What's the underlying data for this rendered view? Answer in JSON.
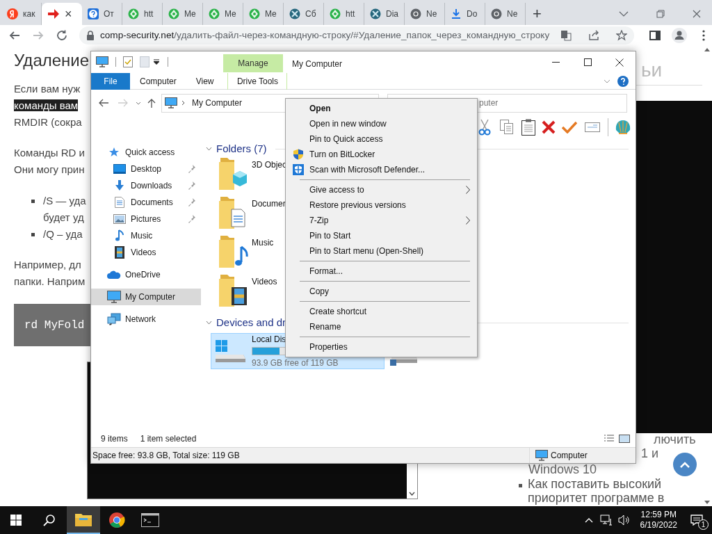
{
  "browser": {
    "tabs": [
      {
        "kind": "yandex",
        "label": "как",
        "selected": false
      },
      {
        "kind": "arrow",
        "close": "×",
        "selected": true
      },
      {
        "kind": "question",
        "label": "От",
        "selected": false
      },
      {
        "kind": "globe",
        "label": "htt",
        "selected": false
      },
      {
        "kind": "globe",
        "label": "Me",
        "selected": false
      },
      {
        "kind": "globe",
        "label": "Me",
        "selected": false
      },
      {
        "kind": "globe",
        "label": "Me",
        "selected": false
      },
      {
        "kind": "xbox",
        "label": "Сб",
        "selected": false
      },
      {
        "kind": "globe",
        "label": "htt",
        "selected": false
      },
      {
        "kind": "xbox",
        "label": "Dia",
        "selected": false
      },
      {
        "kind": "chrome",
        "label": "Ne",
        "selected": false
      },
      {
        "kind": "download",
        "label": "Do",
        "selected": false
      },
      {
        "kind": "chrome",
        "label": "Ne",
        "selected": false
      }
    ],
    "new_tab": "+",
    "url": {
      "domain": "comp-security.net",
      "path": "/удалить-файл-через-командную-строку/#Удаление_папок_через_командную_строку"
    }
  },
  "article": {
    "left": [
      {
        "kind": "heading",
        "text": "Удаление"
      },
      {
        "kind": "paragraph",
        "lines": [
          {
            "text": "Если вам нуж",
            "highlighted": false
          },
          {
            "text": "команды вам",
            "highlighted": true
          },
          {
            "text": "**RMDIR** (сокра",
            "highlighted": false
          }
        ]
      },
      {
        "kind": "paragraph",
        "lines": [
          {
            "text": "Команды **RD** и",
            "highlighted": false
          },
          {
            "text": "Они могу прин",
            "highlighted": false
          }
        ]
      },
      {
        "kind": "bullets",
        "items": [
          {
            "lines": [
              "**/S** — уда",
              "будет уд"
            ]
          },
          {
            "lines": [
              "**/Q** – уда"
            ]
          }
        ]
      },
      {
        "kind": "paragraph",
        "lines": [
          {
            "text": "Например, дл",
            "highlighted": false
          },
          {
            "text": "папки. Наприм",
            "highlighted": false
          }
        ]
      },
      {
        "kind": "code",
        "text": "rd MyFold"
      }
    ],
    "right": {
      "heading": "ьи",
      "lines": [
        "лючить",
        "1 и",
        "Windows 10"
      ],
      "bullets": [
        {
          "lines": [
            "Как поставить высокий",
            "приоритет программе в"
          ]
        }
      ]
    }
  },
  "explorer": {
    "title": "My Computer",
    "context_tab": "Manage",
    "ribbon_tabs": [
      {
        "label": "File",
        "kind": "file"
      },
      {
        "label": "Computer",
        "kind": "tab"
      },
      {
        "label": "View",
        "kind": "tab"
      },
      {
        "label": "Drive Tools",
        "kind": "context"
      }
    ],
    "address": "My Computer",
    "search": "puter",
    "nav": [
      {
        "label": "Quick access",
        "kind": "star",
        "selected": false,
        "children": [
          {
            "label": "Desktop",
            "kind": "desktop",
            "pinned": true,
            "selected": false
          },
          {
            "label": "Downloads",
            "kind": "download",
            "pinned": true,
            "selected": false
          },
          {
            "label": "Documents",
            "kind": "document",
            "pinned": true,
            "selected": false
          },
          {
            "label": "Pictures",
            "kind": "picture",
            "pinned": true,
            "selected": false
          },
          {
            "label": "Music",
            "kind": "music",
            "pinned": false,
            "selected": false
          },
          {
            "label": "Videos",
            "kind": "film",
            "pinned": false,
            "selected": false
          }
        ]
      },
      {
        "label": "OneDrive",
        "kind": "cloud",
        "selected": false
      },
      {
        "label": "My Computer",
        "kind": "monitor",
        "selected": true
      },
      {
        "label": "Network",
        "kind": "network",
        "selected": false
      }
    ],
    "folders": {
      "title": "Folders (7)",
      "items": [
        {
          "label": "3D Objec",
          "kind": "cube"
        },
        {
          "label": "Documer",
          "kind": "document"
        },
        {
          "label": "Music",
          "kind": "music"
        },
        {
          "label": "Videos",
          "kind": "film"
        }
      ]
    },
    "devices": {
      "title": "Devices and dr",
      "drives": [
        {
          "label": "Local Dis",
          "detail": "93.9 GB free of 119 GB",
          "level": 0.21,
          "selected": true
        }
      ]
    },
    "status": {
      "count": "9 items",
      "selection": "1 item selected"
    },
    "details_bar": {
      "space": "Space free: 93.8 GB, Total size: 119 GB",
      "location": "Computer"
    }
  },
  "context_menu": [
    {
      "kind": "item",
      "label": "Open",
      "default": true,
      "submenu": false
    },
    {
      "kind": "item",
      "label": "Open in new window",
      "default": false,
      "submenu": false
    },
    {
      "kind": "item",
      "label": "Pin to Quick access",
      "default": false,
      "submenu": false
    },
    {
      "kind": "shield_item",
      "label": "Turn on BitLocker",
      "default": false,
      "submenu": false
    },
    {
      "kind": "defender_item",
      "label": "Scan with Microsoft Defender...",
      "default": false,
      "submenu": false
    },
    {
      "kind": "separator"
    },
    {
      "kind": "item",
      "label": "Give access to",
      "default": false,
      "submenu": true
    },
    {
      "kind": "item",
      "label": "Restore previous versions",
      "default": false,
      "submenu": false
    },
    {
      "kind": "item",
      "label": "7-Zip",
      "default": false,
      "submenu": true
    },
    {
      "kind": "item",
      "label": "Pin to Start",
      "default": false,
      "submenu": false
    },
    {
      "kind": "item",
      "label": "Pin to Start menu (Open-Shell)",
      "default": false,
      "submenu": false
    },
    {
      "kind": "separator"
    },
    {
      "kind": "item",
      "label": "Format...",
      "default": false,
      "submenu": false
    },
    {
      "kind": "separator"
    },
    {
      "kind": "item",
      "label": "Copy",
      "default": false,
      "submenu": false
    },
    {
      "kind": "separator"
    },
    {
      "kind": "item",
      "label": "Create shortcut",
      "default": false,
      "submenu": false
    },
    {
      "kind": "item",
      "label": "Rename",
      "default": false,
      "submenu": false
    },
    {
      "kind": "separator"
    },
    {
      "kind": "item",
      "label": "Properties",
      "default": false,
      "submenu": false
    }
  ],
  "taskbar": {
    "apps": [
      {
        "kind": "explorer",
        "selected": true
      },
      {
        "kind": "chrome",
        "selected": false
      },
      {
        "kind": "console",
        "selected": false
      }
    ],
    "time": "12:59 PM",
    "date": "6/19/2022",
    "notifications": "1"
  }
}
